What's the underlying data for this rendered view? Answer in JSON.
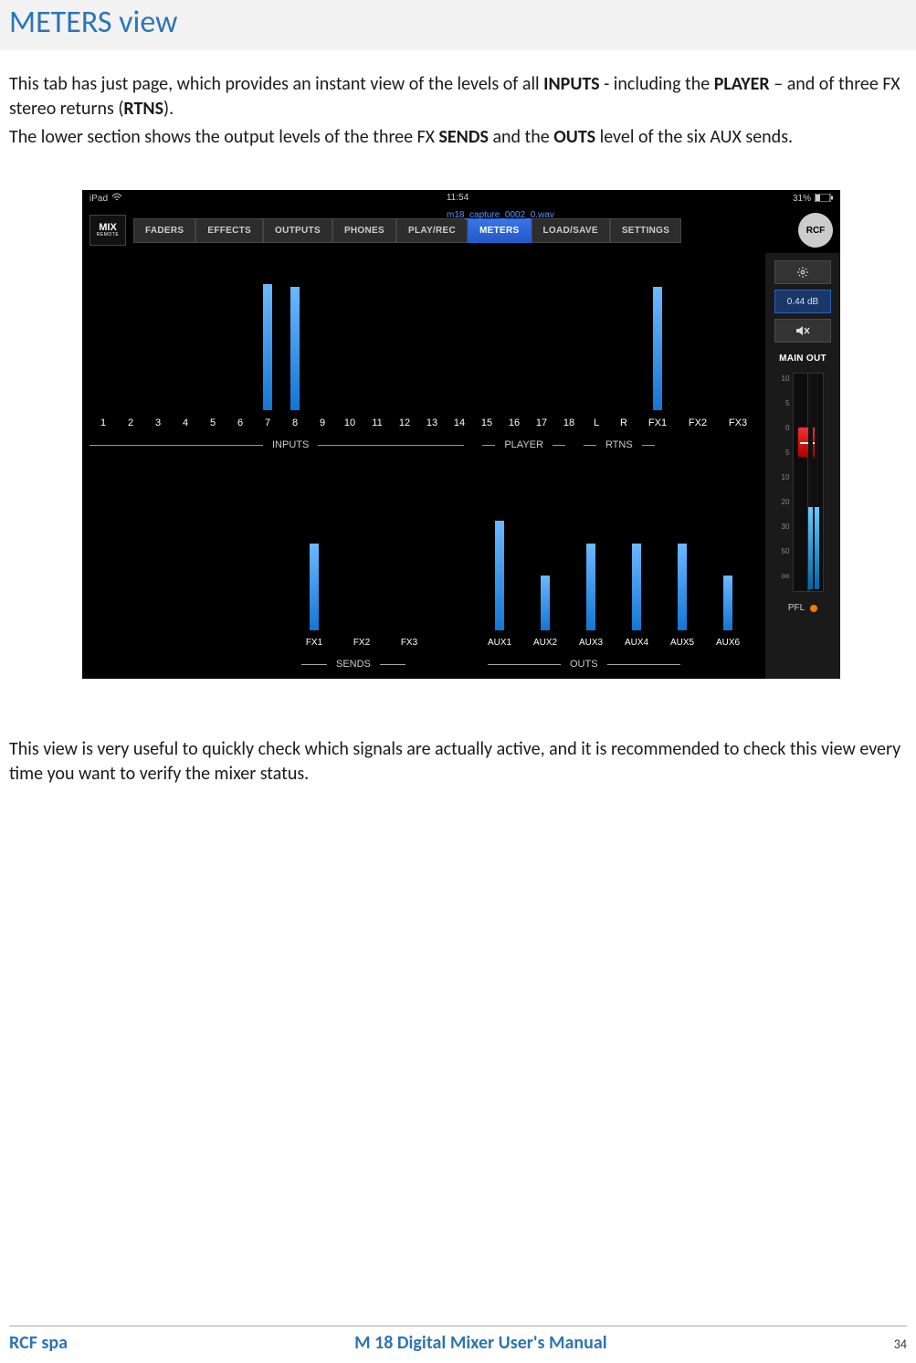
{
  "page": {
    "heading": "METERS view",
    "para1_a": "This tab has just page, which provides an instant view of the levels of all ",
    "para1_b": "INPUTS",
    "para1_c": "  - including the ",
    "para1_d": "PLAYER",
    "para1_e": " – and of three FX stereo returns (",
    "para1_f": "RTNS",
    "para1_g": ").",
    "para2_a": "The lower section shows the output levels of the three FX ",
    "para2_b": "SENDS",
    "para2_c": " and the ",
    "para2_d": "OUTS",
    "para2_e": " level of the six AUX sends.",
    "para3": "This view is very useful to quickly check which signals are actually active, and it is recommended to check this view every time you want to verify the mixer status."
  },
  "footer": {
    "left": "RCF spa",
    "center": "M 18 Digital Mixer User's Manual",
    "page": "34"
  },
  "app": {
    "statusbar": {
      "device": "iPad",
      "time": "11:54",
      "battery": "31%"
    },
    "filename": "m18_capture_0002_0.wav",
    "logo": {
      "line1": "MIX",
      "line2": "REMOTE"
    },
    "brand": "RCF",
    "nav": [
      "FADERS",
      "EFFECTS",
      "OUTPUTS",
      "PHONES",
      "PLAY/REC",
      "METERS",
      "LOAD/SAVE",
      "SETTINGS"
    ],
    "nav_active_index": 5,
    "sidebar": {
      "gain": "0.44 dB",
      "mainout": "MAIN OUT",
      "pfl": "PFL",
      "scale": [
        "10",
        "5",
        "0",
        "5",
        "10",
        "20",
        "30",
        "50",
        "oo"
      ]
    },
    "upper": {
      "items": [
        {
          "label": "1",
          "level": 0
        },
        {
          "label": "2",
          "level": 0
        },
        {
          "label": "3",
          "level": 0
        },
        {
          "label": "4",
          "level": 0
        },
        {
          "label": "5",
          "level": 0
        },
        {
          "label": "6",
          "level": 0
        },
        {
          "label": "7",
          "level": 138
        },
        {
          "label": "8",
          "level": 135
        },
        {
          "label": "9",
          "level": 0
        },
        {
          "label": "10",
          "level": 0
        },
        {
          "label": "11",
          "level": 0
        },
        {
          "label": "12",
          "level": 0
        },
        {
          "label": "13",
          "level": 0
        },
        {
          "label": "14",
          "level": 0
        },
        {
          "label": "15",
          "level": 0
        },
        {
          "label": "16",
          "level": 0
        },
        {
          "label": "17",
          "level": 0
        },
        {
          "label": "18",
          "level": 0
        },
        {
          "label": "L",
          "level": 0
        },
        {
          "label": "R",
          "level": 0
        },
        {
          "label": "FX1",
          "level": 135,
          "fx": true
        },
        {
          "label": "FX2",
          "level": 0,
          "fx": true
        },
        {
          "label": "FX3",
          "level": 0,
          "fx": true
        }
      ],
      "groups": {
        "inputs": "INPUTS",
        "player": "PLAYER",
        "rtns": "RTNS"
      }
    },
    "lower": {
      "sends": [
        {
          "label": "FX1",
          "level": 95
        },
        {
          "label": "FX2",
          "level": 0
        },
        {
          "label": "FX3",
          "level": 0
        }
      ],
      "outs": [
        {
          "label": "AUX1",
          "level": 120
        },
        {
          "label": "AUX2",
          "level": 60
        },
        {
          "label": "AUX3",
          "level": 95
        },
        {
          "label": "AUX4",
          "level": 95
        },
        {
          "label": "AUX5",
          "level": 95
        },
        {
          "label": "AUX6",
          "level": 60
        }
      ],
      "groups": {
        "sends": "SENDS",
        "outs": "OUTS"
      }
    }
  }
}
